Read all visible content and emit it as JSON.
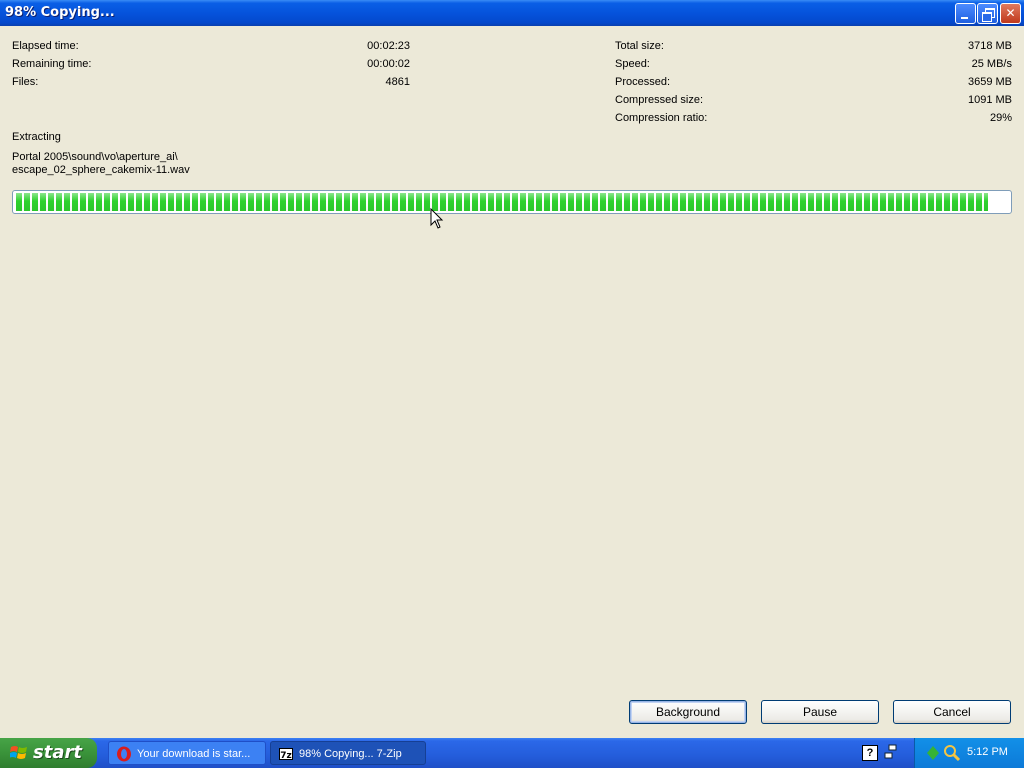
{
  "window": {
    "title": "98% Copying...",
    "buttons": {
      "minimize": "minimize-icon",
      "restore": "restore-icon",
      "close": "close-icon"
    }
  },
  "stats_left": [
    {
      "label": "Elapsed time:",
      "value": "00:02:23"
    },
    {
      "label": "Remaining time:",
      "value": "00:00:02"
    },
    {
      "label": "Files:",
      "value": "4861"
    }
  ],
  "stats_right": [
    {
      "label": "Total size:",
      "value": "3718 MB"
    },
    {
      "label": "Speed:",
      "value": "25 MB/s"
    },
    {
      "label": "Processed:",
      "value": "3659 MB"
    },
    {
      "label": "Compressed size:",
      "value": "1091 MB"
    },
    {
      "label": "Compression ratio:",
      "value": "29%"
    }
  ],
  "operation": "Extracting",
  "current_path_line1": "Portal 2005\\sound\\vo\\aperture_ai\\",
  "current_path_line2": "escape_02_sphere_cakemix-11.wav",
  "progress": {
    "fraction": 0.98,
    "color": "#2dd12d"
  },
  "buttons": {
    "background": "Background",
    "pause": "Pause",
    "cancel": "Cancel"
  },
  "taskbar": {
    "start_label": "start",
    "tasks": [
      {
        "label": "Your download is star...",
        "icon": "opera-icon"
      },
      {
        "label": "98% Copying... 7-Zip",
        "icon": "7zip-icon"
      }
    ],
    "clock": "5:12 PM"
  }
}
